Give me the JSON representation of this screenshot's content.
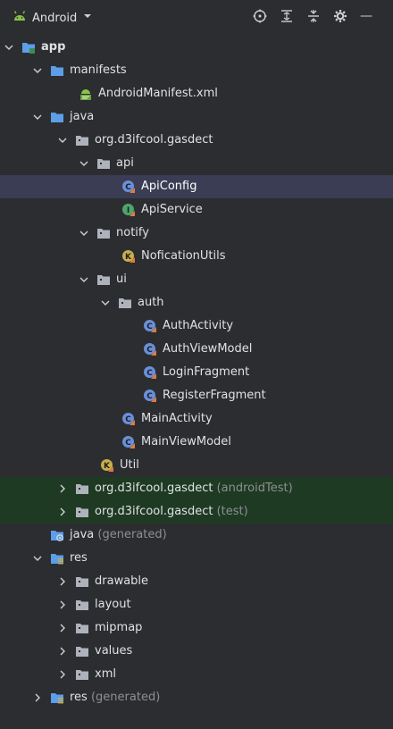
{
  "toolbar": {
    "project_view_label": "Android",
    "icons": [
      "locate-icon",
      "expand-all-icon",
      "collapse-all-icon",
      "settings-icon"
    ]
  },
  "tree": [
    {
      "id": "app",
      "label": "app",
      "type": "module",
      "expanded": true
    },
    {
      "id": "manifests",
      "label": "manifests",
      "type": "folder",
      "expanded": true
    },
    {
      "id": "android-manifest",
      "label": "AndroidManifest.xml",
      "type": "manifest"
    },
    {
      "id": "java",
      "label": "java",
      "type": "folder",
      "expanded": true
    },
    {
      "id": "pkg-main",
      "label": "org.d3ifcool.gasdect",
      "type": "package",
      "expanded": true
    },
    {
      "id": "pkg-api",
      "label": "api",
      "type": "package",
      "expanded": true
    },
    {
      "id": "api-config",
      "label": "ApiConfig",
      "type": "class",
      "selected": true
    },
    {
      "id": "api-service",
      "label": "ApiService",
      "type": "interface"
    },
    {
      "id": "pkg-notify",
      "label": "notify",
      "type": "package",
      "expanded": true
    },
    {
      "id": "notification-utils",
      "label": "NoficationUtils",
      "type": "kt-file"
    },
    {
      "id": "pkg-ui",
      "label": "ui",
      "type": "package",
      "expanded": true
    },
    {
      "id": "pkg-auth",
      "label": "auth",
      "type": "package",
      "expanded": true
    },
    {
      "id": "auth-activity",
      "label": "AuthActivity",
      "type": "class"
    },
    {
      "id": "auth-viewmodel",
      "label": "AuthViewModel",
      "type": "class"
    },
    {
      "id": "login-fragment",
      "label": "LoginFragment",
      "type": "class"
    },
    {
      "id": "register-fragment",
      "label": "RegisterFragment",
      "type": "class"
    },
    {
      "id": "main-activity",
      "label": "MainActivity",
      "type": "class"
    },
    {
      "id": "main-viewmodel",
      "label": "MainViewModel",
      "type": "class"
    },
    {
      "id": "util",
      "label": "Util",
      "type": "kt-file"
    },
    {
      "id": "pkg-android-test",
      "label": "org.d3ifcool.gasdect",
      "suffix": "(androidTest)",
      "type": "package",
      "expanded": false,
      "test": true
    },
    {
      "id": "pkg-test",
      "label": "org.d3ifcool.gasdect",
      "suffix": "(test)",
      "type": "package",
      "expanded": false,
      "test": true
    },
    {
      "id": "java-generated",
      "label": "java",
      "suffix": "(generated)",
      "type": "generated-folder"
    },
    {
      "id": "res",
      "label": "res",
      "type": "res-folder",
      "expanded": true
    },
    {
      "id": "res-drawable",
      "label": "drawable",
      "type": "package",
      "expanded": false
    },
    {
      "id": "res-layout",
      "label": "layout",
      "type": "package",
      "expanded": false
    },
    {
      "id": "res-mipmap",
      "label": "mipmap",
      "type": "package",
      "expanded": false
    },
    {
      "id": "res-values",
      "label": "values",
      "type": "package",
      "expanded": false
    },
    {
      "id": "res-xml",
      "label": "xml",
      "type": "package",
      "expanded": false
    },
    {
      "id": "res-generated",
      "label": "res",
      "suffix": "(generated)",
      "type": "res-folder",
      "expanded": false
    }
  ],
  "colors": {
    "background": "#2b2d30",
    "selected": "#3a3d53",
    "test_row": "#1f3a23",
    "folder": "#5c9ee8",
    "class_icon": "#6b8fd8",
    "interface_icon": "#4fa56b",
    "kt_icon": "#c9b04a",
    "android_green": "#8ac24a"
  }
}
